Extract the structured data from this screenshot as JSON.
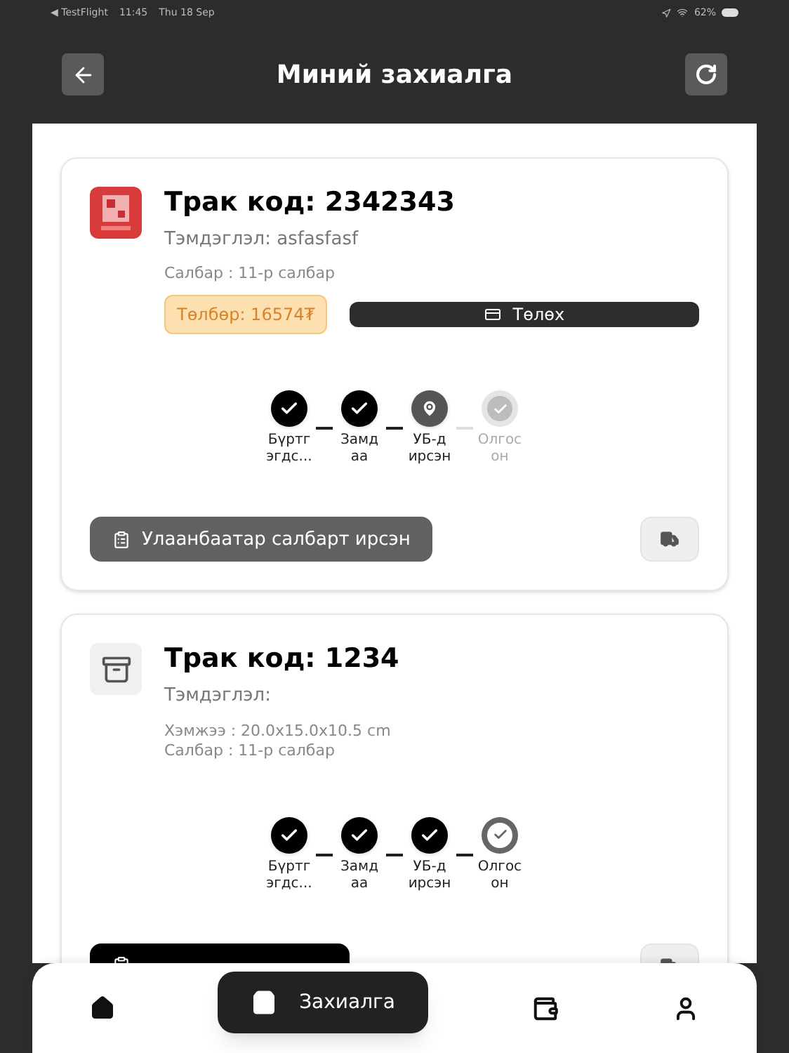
{
  "status_bar": {
    "back_app": "◀ TestFlight",
    "time": "11:45",
    "date": "Thu 18 Sep",
    "battery": "62%"
  },
  "header": {
    "title": "Миний захиалга"
  },
  "orders": [
    {
      "thumb": {
        "kind": "picture"
      },
      "title": "Трак код: 2342343",
      "note": "Тэмдэглэл: asfasfasf",
      "details": [
        "Салбар : 11-р салбар"
      ],
      "fee": "Төлбөр: 16574₮",
      "pay_button": "Төлөх",
      "steps": [
        {
          "label": "Бүртг эгдс...",
          "kind": "done"
        },
        {
          "label": "Замд аа",
          "kind": "done"
        },
        {
          "label": "УБ-д ирсэн",
          "kind": "current"
        },
        {
          "label": "Олгос он",
          "kind": "pending"
        }
      ],
      "status_button": {
        "label": "Улаанбаатар салбарт ирсэн",
        "kind": "gray"
      }
    },
    {
      "thumb": {
        "kind": "archive"
      },
      "title": "Трак код: 1234",
      "note": "Тэмдэглэл:",
      "details": [
        "Хэмжээ : 20.0x15.0x10.5 cm",
        "Салбар : 11-р салбар"
      ],
      "steps": [
        {
          "label": "Бүртг эгдс...",
          "kind": "done"
        },
        {
          "label": "Замд аа",
          "kind": "done"
        },
        {
          "label": "УБ-д ирсэн",
          "kind": "done"
        },
        {
          "label": "Олгос он",
          "kind": "final"
        }
      ],
      "status_button": {
        "kind": "black"
      }
    }
  ],
  "nav": [
    {
      "kind": "home",
      "selected": false
    },
    {
      "kind": "orders",
      "label": "Захиалга",
      "selected": true
    },
    {
      "kind": "wallet",
      "selected": false
    },
    {
      "kind": "profile",
      "selected": false
    }
  ]
}
